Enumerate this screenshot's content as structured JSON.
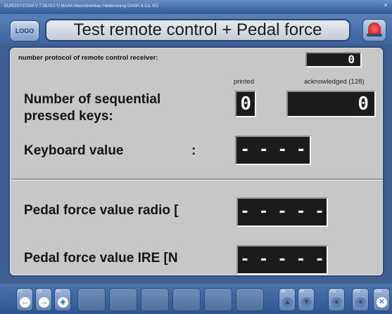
{
  "window": {
    "title": "EUROSYSTEM V 7.08.012  © MAHA Maschinenbau Haldenwang GmbH & Co. KG",
    "close_glyph": "×"
  },
  "header": {
    "logo_label": "LOGO",
    "title": "Test remote control + Pedal force",
    "bell_icon": "alarm-bell-icon"
  },
  "protocol": {
    "label": "number protocol of remote control receiver:",
    "value": "0"
  },
  "columns": {
    "printed": "printed",
    "acknowledged": "acknowledged (128)"
  },
  "sequential": {
    "label_line1": "Number of sequential",
    "label_line2": "pressed keys:",
    "printed_value": "0",
    "acknowledged_value": "0"
  },
  "keyboard": {
    "label": "Keyboard value",
    "colon": ":",
    "value": "- - - -"
  },
  "pedal_radio": {
    "label": "Pedal force value radio [",
    "value": "- - - - -"
  },
  "pedal_ire": {
    "label": "Pedal force value IRE  [N",
    "value": "- - - - -"
  },
  "toolbar": {
    "f2": {
      "label": "F2",
      "icon": "arrow-left-icon",
      "glyph": "←"
    },
    "f3": {
      "label": "F3",
      "icon": "arrow-right-icon",
      "glyph": "→"
    },
    "f4": {
      "label": "F4",
      "icon": "pedal-icon",
      "glyph": "◈"
    },
    "up": {
      "label": "Up",
      "glyph": "▲"
    },
    "dn": {
      "label": "Dn",
      "glyph": "▼"
    },
    "f11": {
      "label": "F11",
      "glyph": "●"
    },
    "f12": {
      "label": "F12",
      "glyph": "●"
    },
    "esc": {
      "label": "ESC",
      "glyph": "✕"
    }
  }
}
